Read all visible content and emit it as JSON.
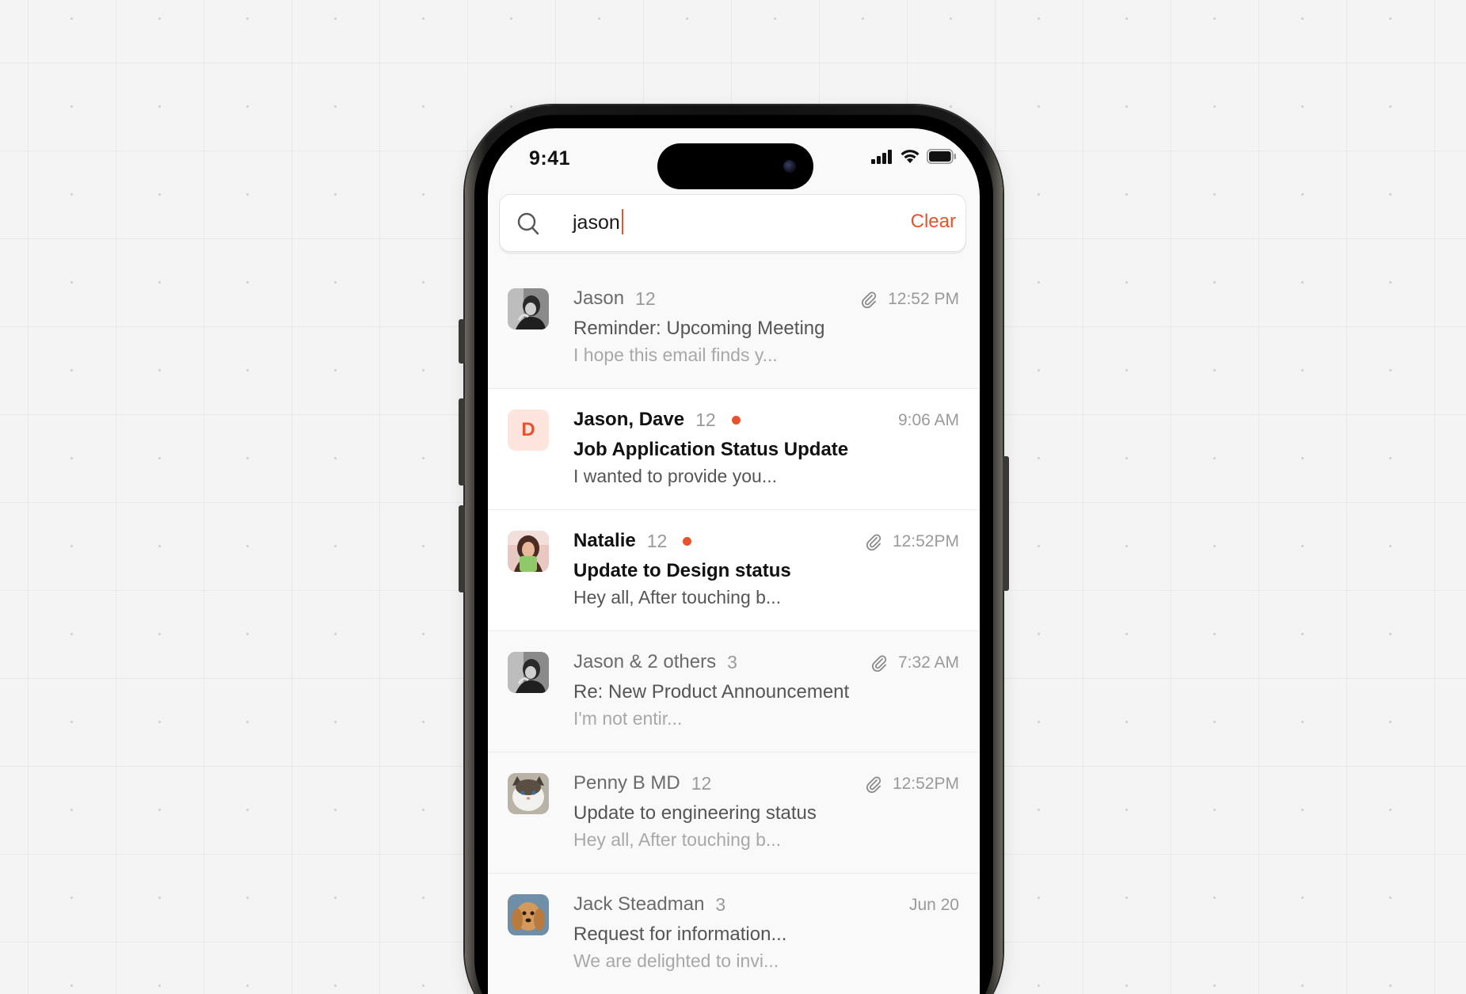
{
  "status_bar": {
    "time": "9:41",
    "icons": [
      "cellular-signal-icon",
      "wifi-icon",
      "battery-icon"
    ]
  },
  "search": {
    "icon": "search-icon",
    "value": "jason",
    "clear_label": "Clear"
  },
  "accent_color": "#e8532f",
  "emails": [
    {
      "sender": "Jason",
      "count": "12",
      "unread": false,
      "attachment": true,
      "time": "12:52 PM",
      "subject": "Reminder: Upcoming Meeting",
      "preview": "I hope this email finds y...",
      "avatar": "photo"
    },
    {
      "sender": "Jason, Dave",
      "count": "12",
      "unread": true,
      "attachment": false,
      "time": "9:06 AM",
      "subject": "Job Application Status Update",
      "preview": "I wanted to provide you...",
      "avatar": "D"
    },
    {
      "sender": "Natalie",
      "count": "12",
      "unread": true,
      "attachment": true,
      "time": "12:52PM",
      "subject": "Update to Design status",
      "preview": "Hey all, After touching b...",
      "avatar": "photo"
    },
    {
      "sender": "Jason & 2 others",
      "count": "3",
      "unread": false,
      "attachment": true,
      "time": "7:32 AM",
      "subject": "Re: New Product Announcement",
      "preview": "I'm not entir...",
      "avatar": "photo"
    },
    {
      "sender": "Penny B MD",
      "count": "12",
      "unread": false,
      "attachment": true,
      "time": "12:52PM",
      "subject": "Update to engineering status",
      "preview": "Hey all, After touching b...",
      "avatar": "photo"
    },
    {
      "sender": "Jack Steadman",
      "count": "3",
      "unread": false,
      "attachment": false,
      "time": "Jun 20",
      "subject": "Request for information...",
      "preview": "We are delighted to invi...",
      "avatar": "photo"
    }
  ]
}
